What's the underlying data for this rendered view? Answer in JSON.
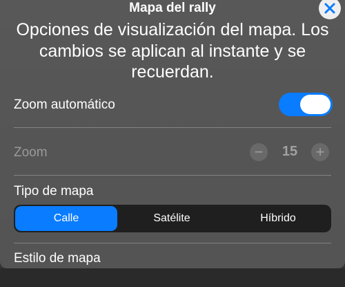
{
  "header": {
    "title": "Mapa del rally",
    "subtitle": "Opciones de visualización del mapa. Los cambios se aplican al instante y se recuerdan."
  },
  "settings": {
    "auto_zoom": {
      "label": "Zoom automático",
      "enabled": true
    },
    "zoom": {
      "label": "Zoom",
      "value": "15",
      "decrement_symbol": "−",
      "increment_symbol": "+",
      "disabled": true
    },
    "map_type": {
      "label": "Tipo de mapa",
      "options": [
        "Calle",
        "Satélite",
        "Híbrido"
      ],
      "selected": "Calle"
    },
    "map_style": {
      "label": "Estilo de mapa"
    }
  },
  "colors": {
    "accent": "#0a7cff",
    "sheet": "#5c5c5c"
  },
  "icons": {
    "close": "close-icon"
  }
}
